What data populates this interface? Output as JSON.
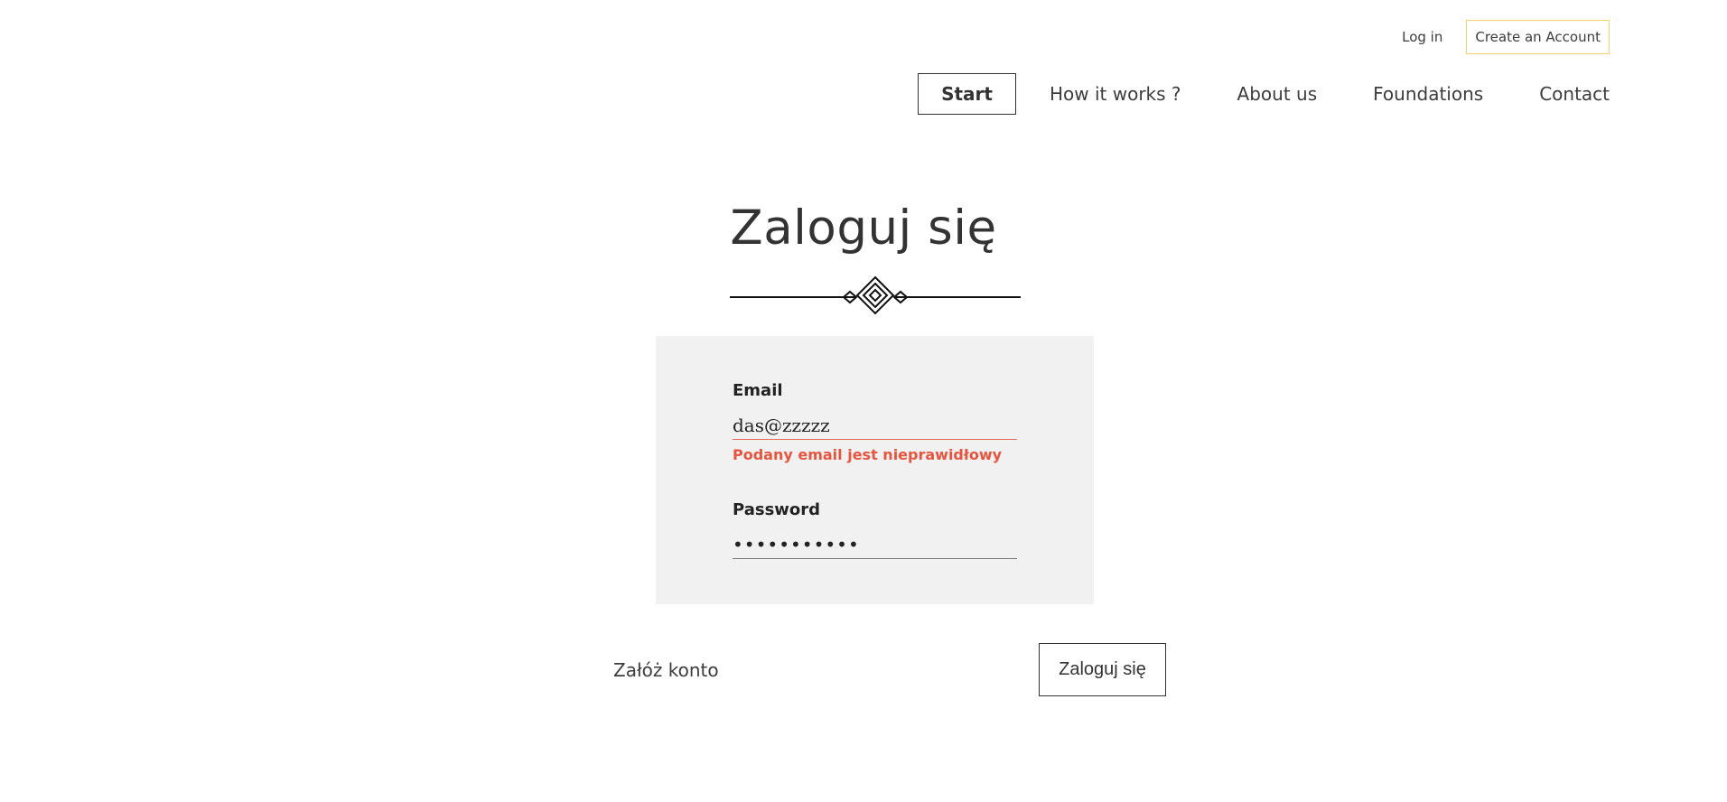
{
  "header": {
    "login_label": "Log in",
    "create_account_label": "Create an Account",
    "nav": [
      {
        "label": "Start"
      },
      {
        "label": "How it works ?"
      },
      {
        "label": "About us"
      },
      {
        "label": "Foundations"
      },
      {
        "label": "Contact"
      }
    ]
  },
  "main": {
    "title": "Zaloguj się",
    "form": {
      "email_label": "Email",
      "email_value": "das@zzzzz",
      "email_error": "Podany email jest nieprawidłowy",
      "password_label": "Password",
      "password_value": "•••••••••••"
    },
    "register_label": "Załóż konto",
    "submit_label": "Zaloguj się"
  },
  "colors": {
    "error": "#e6553f",
    "form_background": "#f0f1f0",
    "create_account_border": "#f4d36b"
  }
}
